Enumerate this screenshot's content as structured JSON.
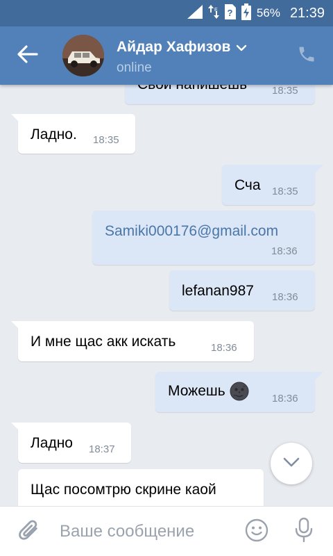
{
  "status_bar": {
    "battery": "56%",
    "time": "21:39",
    "icons": [
      "signal-icon",
      "data-arrows-icon",
      "sim-unknown-icon",
      "battery-charging-icon"
    ]
  },
  "header": {
    "contact_name": "Айдар Хафизов",
    "status": "online",
    "back_icon": "arrow-left-icon",
    "dropdown_icon": "chevron-down-icon",
    "call_icon": "phone-icon"
  },
  "messages": [
    {
      "direction": "out",
      "text": "Свой напишешь",
      "time": "18:35"
    },
    {
      "direction": "in",
      "text": "Ладно.",
      "time": "18:35"
    },
    {
      "direction": "out",
      "text": "Сча",
      "time": "18:35"
    },
    {
      "direction": "out",
      "text": "Samiki000176@gmail.com",
      "time": "18:36"
    },
    {
      "direction": "out",
      "text": "lefanan987",
      "time": "18:36"
    },
    {
      "direction": "in",
      "text": "И мне щас акк искать",
      "time": "18:36"
    },
    {
      "direction": "out",
      "text": "Можешь",
      "emoji": "new-moon-face-emoji",
      "time": "18:36"
    },
    {
      "direction": "in",
      "text": "Ладно",
      "time": "18:37"
    },
    {
      "direction": "in",
      "text": "Щас посомтрю скрине каой",
      "time": ""
    }
  ],
  "scroll_down_icon": "chevron-down-icon",
  "composer": {
    "placeholder": "Ваше сообщение",
    "value": "",
    "attach_icon": "paperclip-icon",
    "emoji_icon": "smiley-icon",
    "mic_icon": "microphone-icon"
  },
  "colors": {
    "status_bar": "#416b9b",
    "app_bar": "#5181b8",
    "background": "#e8ebf0",
    "incoming_bubble": "#ffffff",
    "outgoing_bubble": "#dbe6f6",
    "link": "#4a76a8",
    "time": "#818c99"
  }
}
